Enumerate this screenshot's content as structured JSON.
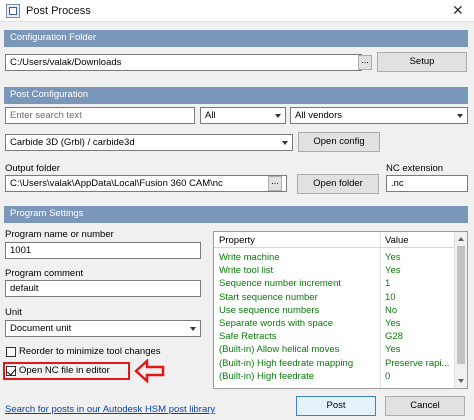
{
  "window": {
    "title": "Post Process",
    "close_glyph": "✕",
    "icon": "app-icon"
  },
  "config_folder": {
    "header": "Configuration Folder",
    "path": "C:/Users/valak/Downloads",
    "browse_label": "...",
    "setup_label": "Setup"
  },
  "post_config": {
    "header": "Post Configuration",
    "search_placeholder": "Enter search text",
    "filter_value": "All",
    "vendor_value": "All vendors",
    "post_value": "Carbide 3D (Grbl) / carbide3d",
    "open_config_label": "Open config"
  },
  "output": {
    "folder_label": "Output folder",
    "folder_path": "C:\\Users\\valak\\AppData\\Local\\Fusion 360 CAM\\nc",
    "browse_label": "...",
    "open_folder_label": "Open folder",
    "nc_ext_label": "NC extension",
    "nc_ext_value": ".nc"
  },
  "program": {
    "header": "Program Settings",
    "name_label": "Program name or number",
    "name_value": "1001",
    "comment_label": "Program comment",
    "comment_value": "default",
    "unit_label": "Unit",
    "unit_value": "Document unit",
    "reorder_label": "Reorder to minimize tool changes",
    "reorder_checked": false,
    "open_nc_label": "Open NC file in editor",
    "open_nc_checked": true
  },
  "properties": {
    "col_property": "Property",
    "col_value": "Value",
    "rows": [
      {
        "property": "Write machine",
        "value": "Yes"
      },
      {
        "property": "Write tool list",
        "value": "Yes"
      },
      {
        "property": "Sequence number increment",
        "value": "1"
      },
      {
        "property": "Start sequence number",
        "value": "10"
      },
      {
        "property": "Use sequence numbers",
        "value": "No"
      },
      {
        "property": "Separate words with space",
        "value": "Yes"
      },
      {
        "property": "Safe Retracts",
        "value": "G28"
      },
      {
        "property": "(Built-in) Allow helical moves",
        "value": "Yes"
      },
      {
        "property": "(Built-in) High feedrate mapping",
        "value": "Preserve rapi..."
      },
      {
        "property": "(Built-in) High feedrate",
        "value": "0"
      }
    ]
  },
  "footer": {
    "link_text": "Search for posts in our Autodesk HSM post library",
    "post_label": "Post",
    "cancel_label": "Cancel"
  },
  "annotation": {
    "color": "#e01818"
  },
  "colors": {
    "section_header": "#7a97b9",
    "property_text": "#0a7a0a",
    "link": "#0645ad"
  }
}
